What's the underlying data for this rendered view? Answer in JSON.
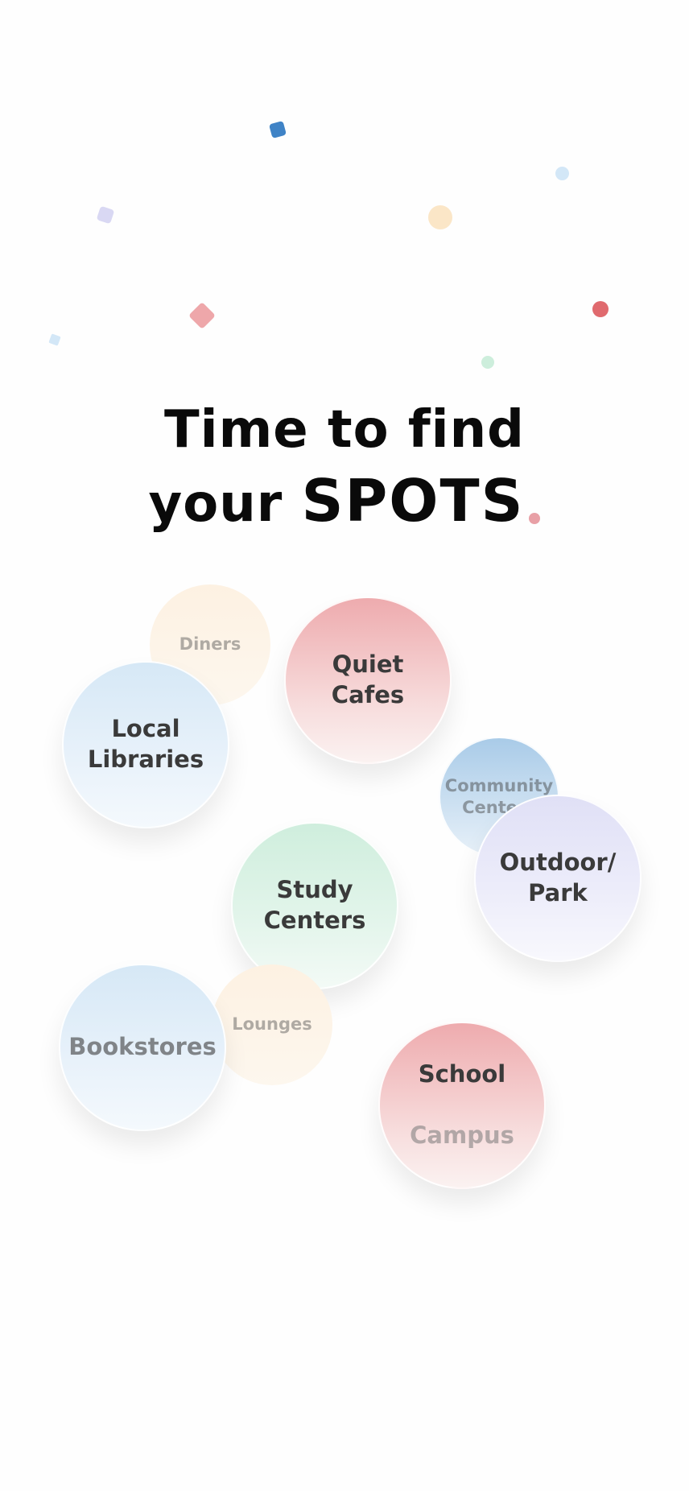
{
  "headline": {
    "line1": "Time to find",
    "line2_prefix": "your ",
    "line2_highlight": "SPOTS"
  },
  "bubbles": {
    "diners": "Diners",
    "quiet_cafes": "Quiet\nCafes",
    "local_libraries": "Local\nLibraries",
    "community_centers": "Community\nCenters",
    "outdoor_park": "Outdoor/\nPark",
    "study_centers": "Study\nCenters",
    "lounges": "Lounges",
    "bookstores": "Bookstores",
    "school_campus_line1": "School",
    "school_campus_line2": "Campus"
  },
  "colors": {
    "headline": "#0a0a0a",
    "pink": "#eeabae",
    "blue": "#d6e8f6",
    "green": "#cfeedd",
    "lavender": "#e0e0f6",
    "peach": "#fdf1e2",
    "accent_dot": "#e8a0a6"
  }
}
